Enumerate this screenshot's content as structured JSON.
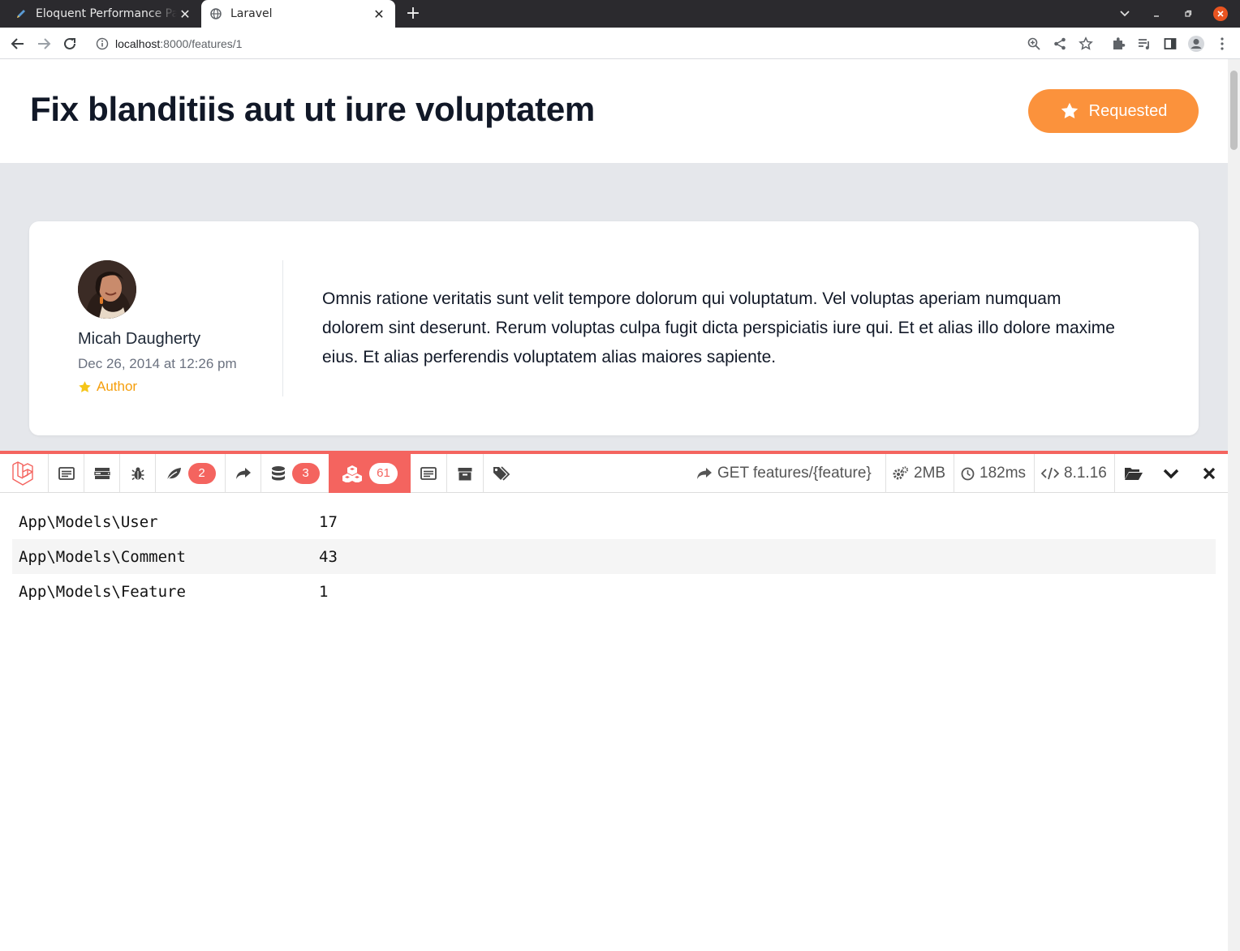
{
  "browser": {
    "tabs": [
      {
        "title": "Eloquent Performance Pa",
        "favicon": "pencil-icon",
        "active": false
      },
      {
        "title": "Laravel",
        "favicon": "globe-icon",
        "active": true
      }
    ],
    "new_tab_label": "+",
    "url_host": "localhost",
    "url_rest": ":8000/features/1"
  },
  "header": {
    "title": "Fix blanditiis aut ut iure voluptatem",
    "requested_label": "Requested"
  },
  "comment": {
    "author": "Micah Daugherty",
    "date": "Dec 26, 2014 at 12:26 pm",
    "badge": "Author",
    "body": "Omnis ratione veritatis sunt velit tempore dolorum qui voluptatum. Vel voluptas aperiam numquam dolorem sint deserunt. Rerum voluptas culpa fugit dicta perspiciatis iure qui. Et et alias illo dolore maxime eius. Et alias perferendis voluptatem alias maiores sapiente."
  },
  "debugbar": {
    "badges": {
      "views": "2",
      "queries": "3",
      "models": "61"
    },
    "route": "GET features/{feature}",
    "memory": "2MB",
    "time": "182ms",
    "php_version": "8.1.16",
    "models": [
      {
        "name": "App\\Models\\User",
        "count": "17"
      },
      {
        "name": "App\\Models\\Comment",
        "count": "43"
      },
      {
        "name": "App\\Models\\Feature",
        "count": "1"
      }
    ]
  },
  "colors": {
    "accent_orange": "#fb923c",
    "debugbar_red": "#f4645f",
    "author_yellow": "#f59e0b"
  }
}
